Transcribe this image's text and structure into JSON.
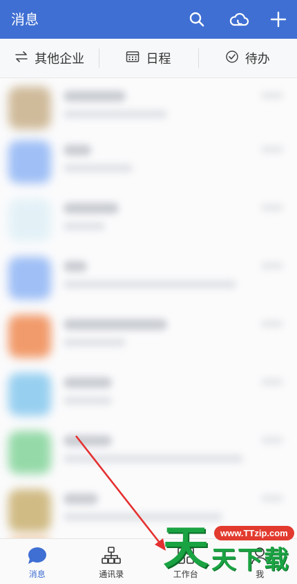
{
  "header": {
    "title": "消息",
    "icons": [
      "search-icon",
      "cloud-phone-icon",
      "plus-icon"
    ]
  },
  "quickbar": {
    "items": [
      {
        "label": "其他企业",
        "icon": "switch-arrows-icon"
      },
      {
        "label": "日程",
        "icon": "calendar-icon"
      },
      {
        "label": "待办",
        "icon": "check-circle-icon"
      }
    ]
  },
  "conversations": {
    "note": "",
    "avatar_colors": [
      "#c8b08a",
      "#8fb5f5",
      "#dff0f7",
      "#8fb5f5",
      "#f08a52",
      "#86c8ee",
      "#84d49a",
      "#c9b070",
      "#f0c9a2"
    ]
  },
  "tabbar": {
    "items": [
      {
        "label": "消息",
        "icon": "message-bubble-icon",
        "active": true
      },
      {
        "label": "通讯录",
        "icon": "org-chart-icon",
        "active": false
      },
      {
        "label": "工作台",
        "icon": "workbench-icon",
        "active": false
      },
      {
        "label": "我",
        "icon": "profile-icon",
        "active": false
      }
    ]
  },
  "watermark": {
    "url": "www.TTzip.com",
    "big": "天",
    "small": "天下载"
  },
  "colors": {
    "header_bg": "#3f6fd3",
    "active_tab": "#3f6fd3",
    "arrow": "#e53030",
    "watermark_green": "#1aa342"
  }
}
